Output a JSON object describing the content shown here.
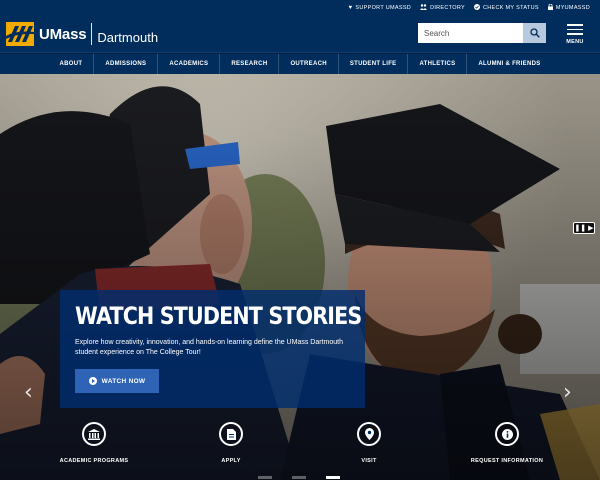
{
  "utility": {
    "links": [
      {
        "label": "SUPPORT UMASSD",
        "icon": "heart-icon"
      },
      {
        "label": "DIRECTORY",
        "icon": "people-icon"
      },
      {
        "label": "CHECK MY STATUS",
        "icon": "check-circle-icon"
      },
      {
        "label": "MYUMASSD",
        "icon": "lock-icon"
      }
    ]
  },
  "header": {
    "logo_primary": "UMass",
    "logo_secondary": "Dartmouth",
    "search_placeholder": "Search",
    "menu_label": "MENU"
  },
  "nav": {
    "items": [
      "ABOUT",
      "ADMISSIONS",
      "ACADEMICS",
      "RESEARCH",
      "OUTREACH",
      "STUDENT LIFE",
      "ATHLETICS",
      "ALUMNI & FRIENDS"
    ]
  },
  "hero": {
    "title": "WATCH STUDENT STORIES",
    "description": "Explore how creativity, innovation, and hands-on learning define the UMass Dartmouth student experience on The College Tour!",
    "button_label": "WATCH NOW",
    "prev_glyph": "‹",
    "next_glyph": "›"
  },
  "quick_links": [
    {
      "label": "ACADEMIC PROGRAMS",
      "icon": "building-icon"
    },
    {
      "label": "APPLY",
      "icon": "document-icon"
    },
    {
      "label": "VISIT",
      "icon": "map-pin-icon"
    },
    {
      "label": "REQUEST INFORMATION",
      "icon": "info-icon"
    }
  ],
  "colors": {
    "brand_navy": "#002d5c",
    "brand_gold": "#f2a900",
    "button_blue": "#2f63b5"
  }
}
